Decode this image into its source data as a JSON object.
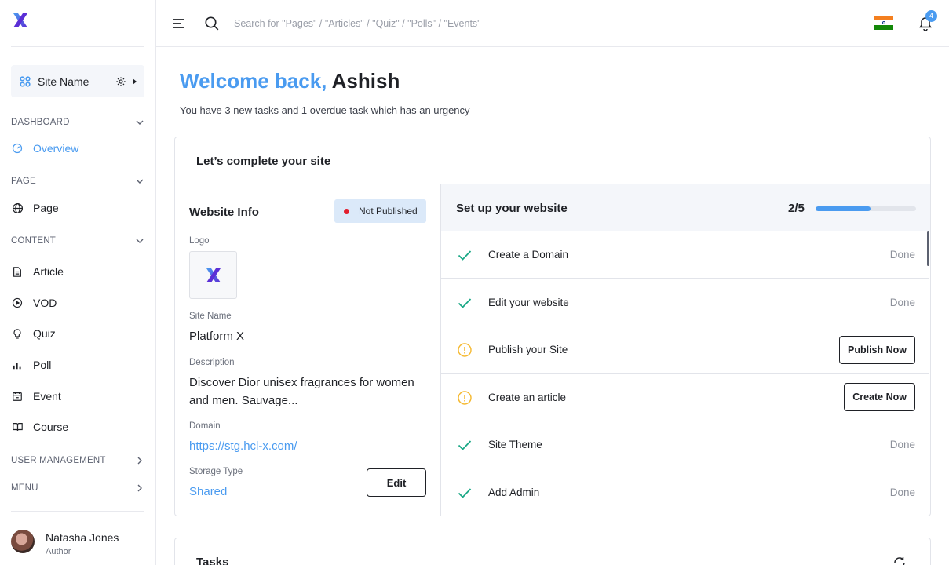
{
  "sidebar": {
    "site_name": "Site Name",
    "sections": {
      "dashboard": "DASHBOARD",
      "page": "PAGE",
      "content": "CONTENT",
      "user_management": "USER MANAGEMENT",
      "menu": "MENU"
    },
    "items": {
      "overview": "Overview",
      "page": "Page",
      "article": "Article",
      "vod": "VOD",
      "quiz": "Quiz",
      "poll": "Poll",
      "event": "Event",
      "course": "Course"
    },
    "user": {
      "name": "Natasha Jones",
      "role": "Author"
    }
  },
  "topbar": {
    "search_placeholder": "Search for \"Pages\" / \"Articles\" / \"Quiz\" / \"Polls\" / \"Events\"",
    "notification_count": "4",
    "flag_colors": [
      "#f47f1f",
      "#ffffff",
      "#138808"
    ]
  },
  "main": {
    "welcome_prefix": "Welcome back,",
    "welcome_name": "Ashish",
    "subtitle": "You have 3 new tasks and 1 overdue task which has an urgency"
  },
  "site_card": {
    "title": "Let’s complete your site",
    "info": {
      "title": "Website Info",
      "status": "Not Published",
      "logo_label": "Logo",
      "site_name_label": "Site Name",
      "site_name": "Platform X",
      "description_label": "Description",
      "description": "Discover Dior unisex fragrances for women and men. Sauvage...",
      "domain_label": "Domain",
      "domain": "https://stg.hcl-x.com/",
      "storage_label": "Storage Type",
      "storage": "Shared",
      "edit_label": "Edit"
    },
    "setup": {
      "title": "Set up your website",
      "progress_text": "2/5",
      "progress_percent": 55,
      "steps": [
        {
          "label": "Create a Domain",
          "state": "done",
          "status": "Done"
        },
        {
          "label": "Edit your website",
          "state": "done",
          "status": "Done"
        },
        {
          "label": "Publish your Site",
          "state": "pending",
          "action": "Publish Now"
        },
        {
          "label": "Create an article",
          "state": "pending",
          "action": "Create Now"
        },
        {
          "label": "Site Theme",
          "state": "done",
          "status": "Done"
        },
        {
          "label": "Add Admin",
          "state": "done",
          "status": "Done"
        }
      ]
    }
  },
  "tasks": {
    "title": "Tasks"
  },
  "colors": {
    "accent": "#4a9bf0",
    "done": "#1aa886",
    "pending": "#f5b82e",
    "danger": "#e21e2d"
  }
}
